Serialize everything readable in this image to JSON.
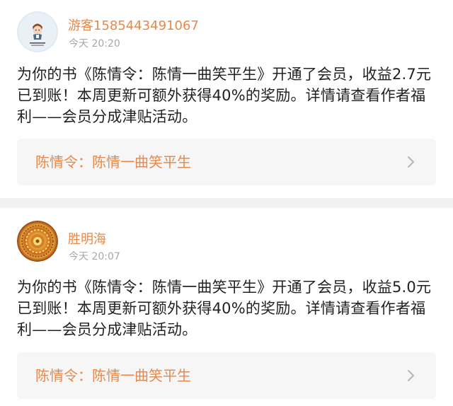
{
  "notifications": [
    {
      "username": "游客1585443491067",
      "timestamp": "今天 20:20",
      "message": "为你的书《陈情令：陈情一曲笑平生》开通了会员，收益2.7元已到账！本周更新可额外获得40%的奖励。详情请查看作者福利——会员分成津贴活动。",
      "link_title": "陈情令：陈情一曲笑平生",
      "avatar_icon": "cartoon-person-avatar-icon"
    },
    {
      "username": "胜明海",
      "timestamp": "今天 20:07",
      "message": "为你的书《陈情令：陈情一曲笑平生》开通了会员，收益5.0元已到账！本周更新可额外获得40%的奖励。详情请查看作者福利——会员分成津贴活动。",
      "link_title": "陈情令：陈情一曲笑平生",
      "avatar_icon": "mandala-avatar-icon"
    }
  ],
  "colors": {
    "accent": "#e8884a",
    "text": "#222222",
    "muted": "#a8a8a8",
    "link_bg": "#f6f6f6",
    "divider": "#f1f1f1"
  }
}
